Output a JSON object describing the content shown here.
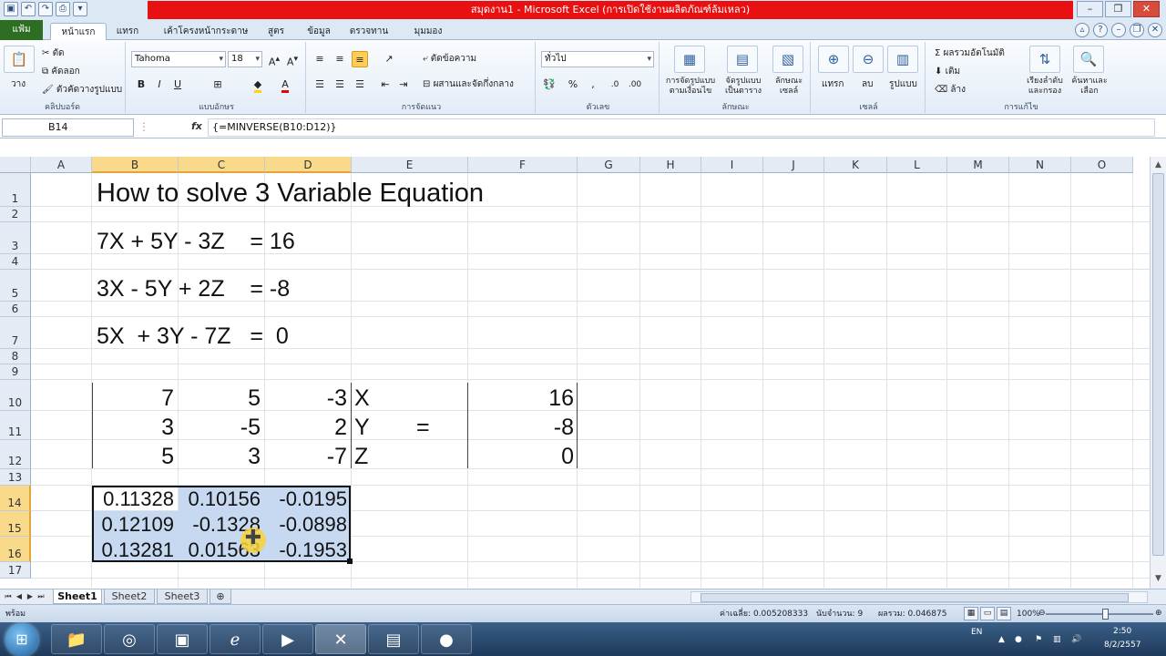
{
  "titlebar": {
    "title": "สมุดงาน1 - Microsoft Excel (การเปิดใช้งานผลิตภัณฑ์ล้มเหลว)",
    "quick_access": [
      "save-icon",
      "undo-icon",
      "redo-icon",
      "print-preview-icon",
      "customize-icon"
    ]
  },
  "ribbon_tabs": {
    "file": "แฟ้ม",
    "tabs": [
      "หน้าแรก",
      "แทรก",
      "เค้าโครงหน้ากระดาษ",
      "สูตร",
      "ข้อมูล",
      "ตรวจทาน",
      "มุมมอง"
    ],
    "active": "หน้าแรก"
  },
  "ribbon": {
    "clipboard": {
      "paste": "วาง",
      "cut": "ตัด",
      "copy": "คัดลอก",
      "format_painter": "ตัวคัดวางรูปแบบ",
      "label": "คลิปบอร์ด"
    },
    "font": {
      "name": "Tahoma",
      "size": "18",
      "bold": "B",
      "italic": "I",
      "underline": "U",
      "label": "แบบอักษร"
    },
    "alignment": {
      "wrap": "ตัดข้อความ",
      "merge": "ผสานและจัดกึ่งกลาง",
      "label": "การจัดแนว"
    },
    "number": {
      "format": "ทั่วไป",
      "label": "ตัวเลข"
    },
    "styles": {
      "conditional": "การจัดรูปแบบตามเงื่อนไข",
      "table": "จัดรูปแบบเป็นตาราง",
      "cell": "ลักษณะเซลล์",
      "label": "ลักษณะ"
    },
    "cells": {
      "insert": "แทรก",
      "delete": "ลบ",
      "format": "รูปแบบ",
      "label": "เซลล์"
    },
    "editing": {
      "autosum": "ผลรวมอัตโนมัติ",
      "fill": "เติม",
      "clear": "ล้าง",
      "sort": "เรียงลำดับและกรอง",
      "find": "ค้นหาและเลือก",
      "label": "การแก้ไข"
    }
  },
  "formula_bar": {
    "namebox": "B14",
    "fx": "fx",
    "formula": "{=MINVERSE(B10:D12)}"
  },
  "grid": {
    "columns": [
      "A",
      "B",
      "C",
      "D",
      "E",
      "F",
      "G",
      "H",
      "I",
      "J",
      "K",
      "L",
      "M",
      "N",
      "O"
    ],
    "selected_columns": [
      "B",
      "C",
      "D"
    ],
    "rows": [
      "1",
      "2",
      "3",
      "4",
      "5",
      "6",
      "7",
      "8",
      "9",
      "10",
      "11",
      "12",
      "13",
      "14",
      "15",
      "16",
      "17"
    ],
    "selected_rows": [
      "14",
      "15",
      "16"
    ],
    "title": "How to solve 3 Variable Equation",
    "equations": [
      "7X + 5Y - 3Z    = 16",
      "3X - 5Y + 2Z    = -8",
      "5X  + 3Y - 7Z   =  0"
    ],
    "matrix": [
      [
        "7",
        "5",
        "-3"
      ],
      [
        "3",
        "-5",
        "2"
      ],
      [
        "5",
        "3",
        "-7"
      ]
    ],
    "variables": [
      "X",
      "Y",
      "Z"
    ],
    "equals": "=",
    "constants": [
      "16",
      "-8",
      "0"
    ],
    "inverse": [
      [
        "0.11328",
        "0.10156",
        "-0.0195"
      ],
      [
        "0.12109",
        "-0.1328",
        "-0.0898"
      ],
      [
        "0.13281",
        "0.01563",
        "-0.1953"
      ]
    ]
  },
  "sheets": {
    "tabs": [
      "Sheet1",
      "Sheet2",
      "Sheet3"
    ],
    "active": "Sheet1"
  },
  "statusbar": {
    "mode": "พร้อม",
    "average": "ค่าเฉลี่ย: 0.005208333",
    "count": "นับจำนวน: 9",
    "sum": "ผลรวม: 0.046875",
    "zoom": "100%"
  },
  "taskbar": {
    "apps": [
      "explorer-icon",
      "chrome-icon",
      "taskmgr-icon",
      "ie-icon",
      "media-player-icon",
      "excel-icon",
      "folder-icon",
      "recorder-icon"
    ],
    "lang": "EN",
    "time": "2:50",
    "date": "8/2/2557"
  }
}
